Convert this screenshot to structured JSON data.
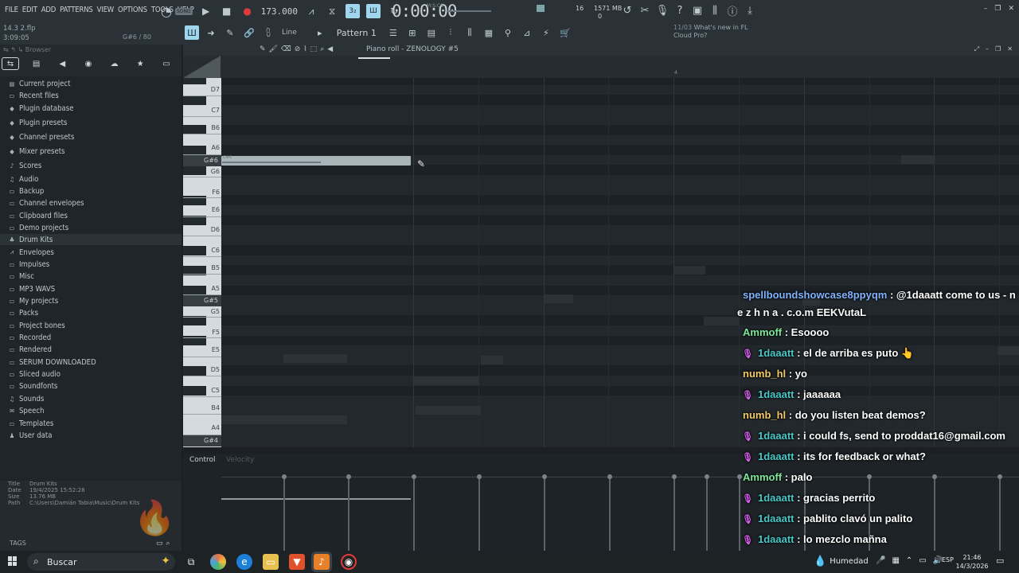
{
  "menu": [
    "FILE",
    "EDIT",
    "ADD",
    "PATTERNS",
    "VIEW",
    "OPTIONS",
    "TOOLS",
    "HELP"
  ],
  "project": {
    "name": "14.3 2.flp",
    "time": "3:09:05",
    "hint_right": "G#6 / 80"
  },
  "transport": {
    "song_label": "SONG",
    "tempo": "173.000",
    "timecode": "0:00:00",
    "timecode_unit": "M:S:CS"
  },
  "cpu": {
    "voices": "16",
    "memory": "1571 MB",
    "memory2": "0"
  },
  "toolbar2": {
    "mode_label": "Line",
    "pattern": "Pattern 1"
  },
  "news": {
    "date": "11/03",
    "text_line1": "What's new in FL",
    "text_line2": "Cloud Pro?"
  },
  "browser": {
    "title": "Browser",
    "items": [
      {
        "label": "Current project",
        "icon": "project-icon"
      },
      {
        "label": "Recent files",
        "icon": "folder-icon"
      },
      {
        "label": "Plugin database",
        "icon": "plug-icon"
      },
      {
        "label": "Plugin presets",
        "icon": "plug-icon"
      },
      {
        "label": "Channel presets",
        "icon": "plug-icon"
      },
      {
        "label": "Mixer presets",
        "icon": "plug-icon"
      },
      {
        "label": "Scores",
        "icon": "note-icon"
      },
      {
        "label": "Audio",
        "icon": "audio-icon"
      },
      {
        "label": "Backup",
        "icon": "folder-icon"
      },
      {
        "label": "Channel envelopes",
        "icon": "folder-icon"
      },
      {
        "label": "Clipboard files",
        "icon": "folder-icon"
      },
      {
        "label": "Demo projects",
        "icon": "folder-icon"
      },
      {
        "label": "Drum Kits",
        "icon": "drum-icon"
      },
      {
        "label": "Envelopes",
        "icon": "envelope-icon"
      },
      {
        "label": "Impulses",
        "icon": "folder-icon"
      },
      {
        "label": "Misc",
        "icon": "folder-icon"
      },
      {
        "label": "MP3 WAVS",
        "icon": "folder-icon"
      },
      {
        "label": "My projects",
        "icon": "folder-icon"
      },
      {
        "label": "Packs",
        "icon": "folder-icon"
      },
      {
        "label": "Project bones",
        "icon": "folder-icon"
      },
      {
        "label": "Recorded",
        "icon": "folder-icon"
      },
      {
        "label": "Rendered",
        "icon": "folder-icon"
      },
      {
        "label": "SERUM DOWNLOADED",
        "icon": "folder-icon"
      },
      {
        "label": "Sliced audio",
        "icon": "folder-icon"
      },
      {
        "label": "Soundfonts",
        "icon": "folder-icon"
      },
      {
        "label": "Sounds",
        "icon": "audio-icon"
      },
      {
        "label": "Speech",
        "icon": "speech-icon"
      },
      {
        "label": "Templates",
        "icon": "folder-icon"
      },
      {
        "label": "User data",
        "icon": "user-icon"
      }
    ],
    "selected_item": "Drum Kits",
    "info": {
      "title_k": "Title",
      "title_v": "Drum Kits",
      "date_k": "Date",
      "date_v": "19/4/2025 15:52:28",
      "size_k": "Size",
      "size_v": "13.76 MB",
      "path_k": "Path",
      "path_v": "C:\\Users\\Damián Tabia\\Music\\Drum Kits"
    },
    "tags_label": "TAGS"
  },
  "piano_roll": {
    "title": "Piano roll - ZENOLOGY #5",
    "bar_marker": "4",
    "keys": [
      "D7",
      "C7",
      "B6",
      "A6",
      "G#6",
      "G6",
      "F6",
      "E6",
      "D6",
      "C6",
      "B5",
      "A5",
      "G#5",
      "G5",
      "F5",
      "E5",
      "D5",
      "C5",
      "B4",
      "A4",
      "G#4"
    ],
    "highlighted_keys": [
      "G#6",
      "G#5",
      "G#4"
    ],
    "note": {
      "label": "G#6"
    },
    "control_label": "Control",
    "control_sublabel": "Velocity"
  },
  "chat": [
    {
      "user": "spellboundshowcase8ppyqm",
      "text": " : @1daaatt come to us - n e z h n a . c.o.m EEKVutaL",
      "color": "u-spell",
      "mic": false
    },
    {
      "user": "Ammoff",
      "text": " : Esoooo",
      "color": "u-amm",
      "mic": false
    },
    {
      "user": "1daaatt",
      "text": " : el de arriba es puto 👆",
      "color": "u-1da",
      "mic": true
    },
    {
      "user": "numb_hl",
      "text": " : yo",
      "color": "u-numb",
      "mic": false
    },
    {
      "user": "1daaatt",
      "text": " : jaaaaaa",
      "color": "u-1da",
      "mic": true
    },
    {
      "user": "numb_hl",
      "text": " : do you listen beat demos?",
      "color": "u-numb",
      "mic": false
    },
    {
      "user": "1daaatt",
      "text": " : i could fs, send to proddat16@gmail.com",
      "color": "u-1da",
      "mic": true
    },
    {
      "user": "1daaatt",
      "text": " : its for feedback or what?",
      "color": "u-1da",
      "mic": true
    },
    {
      "user": "Ammoff",
      "text": " : palo",
      "color": "u-amm",
      "mic": false
    },
    {
      "user": "1daaatt",
      "text": " : gracias perrito",
      "color": "u-1da",
      "mic": true
    },
    {
      "user": "1daaatt",
      "text": " : pablito clavó un palito",
      "color": "u-1da",
      "mic": true
    },
    {
      "user": "1daaatt",
      "text": " : lo mezclo mañna",
      "color": "u-1da",
      "mic": true
    }
  ],
  "taskbar": {
    "search_placeholder": "Buscar",
    "weather": "Humedad",
    "lang": "ESP",
    "time": "21:46",
    "date": "14/3/2026"
  }
}
